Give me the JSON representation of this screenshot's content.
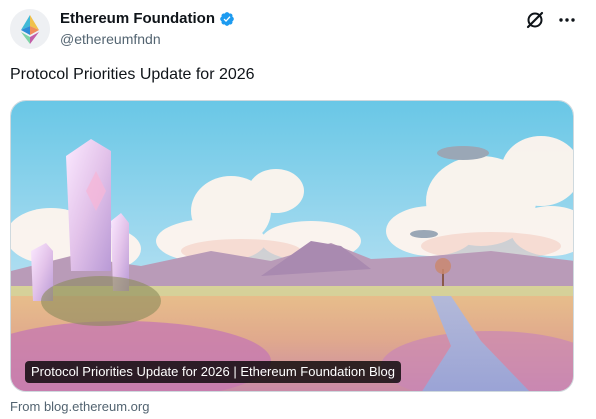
{
  "author": {
    "display_name": "Ethereum Foundation",
    "handle": "@ethereumfndn",
    "verified": true,
    "avatar_icon": "ethereum-logo-icon"
  },
  "actions": {
    "grok_icon": "grok-icon",
    "more_icon": "more-icon"
  },
  "post": {
    "text": "Protocol Priorities Update for 2026"
  },
  "link_card": {
    "title": "Protocol Priorities Update for 2026 | Ethereum Foundation Blog",
    "source": "From blog.ethereum.org",
    "image": "illustration-crystal-tower-desert-road-airships"
  },
  "colors": {
    "verified_blue": "#1d9bf0",
    "text_primary": "#0f1419",
    "text_secondary": "#536471",
    "border": "#cfd9de"
  }
}
